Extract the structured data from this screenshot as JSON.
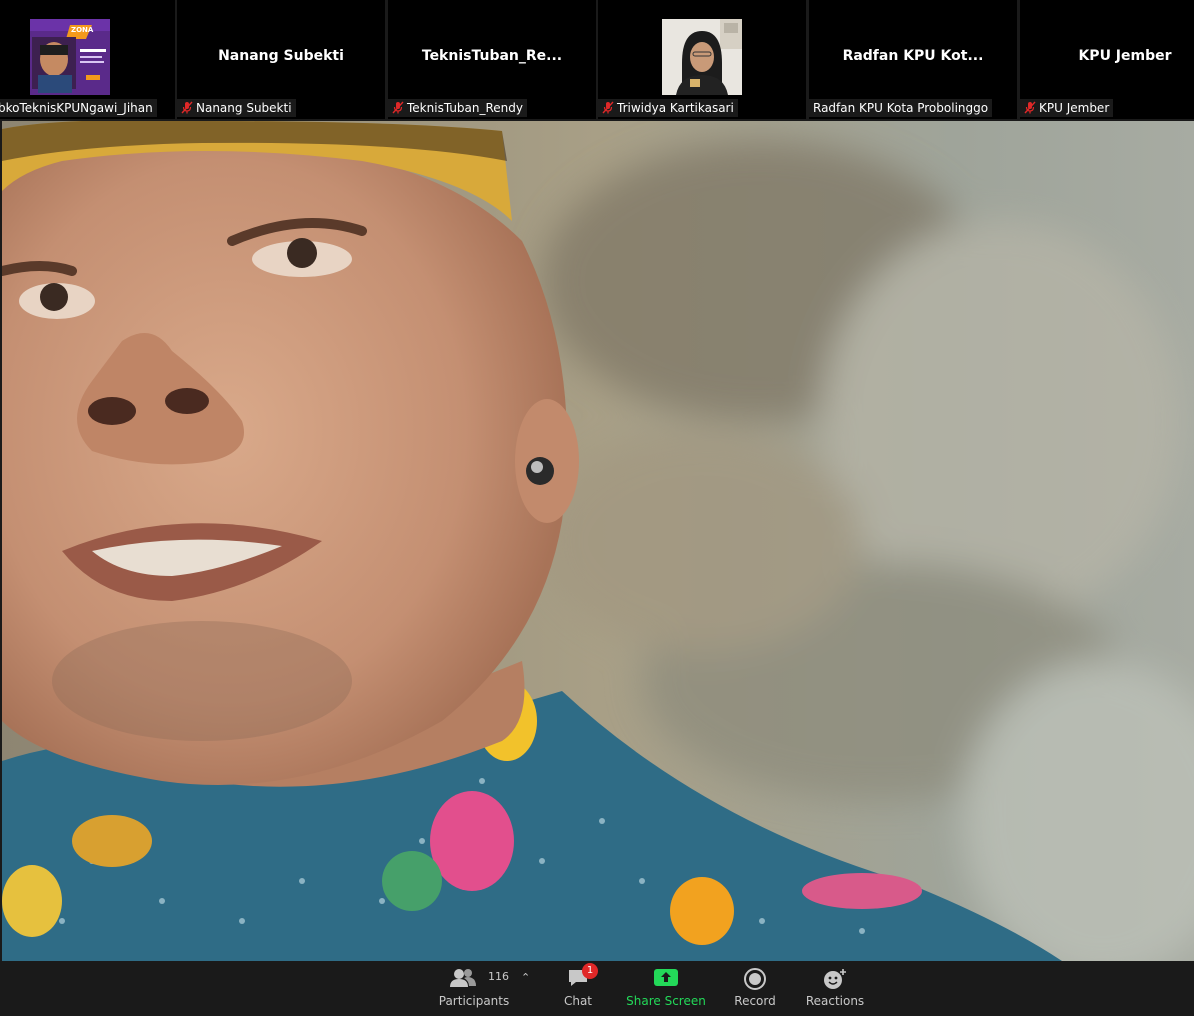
{
  "gallery": {
    "tiles": [
      {
        "label": "bkoTeknisKPUNgawi_Jihan",
        "muted": false
      },
      {
        "name": "Nanang Subekti",
        "label": "Nanang Subekti",
        "muted": true
      },
      {
        "name": "TeknisTuban_Re...",
        "label": "TeknisTuban_Rendy",
        "muted": true
      },
      {
        "label": "Triwidya Kartikasari",
        "muted": true
      },
      {
        "name": "Radfan KPU Kot...",
        "label": "Radfan KPU Kota Probolinggo",
        "muted": false
      },
      {
        "name": "KPU Jember",
        "label": "KPU Jember",
        "muted": true
      }
    ],
    "thumb_text": "ZONA"
  },
  "toolbar": {
    "participants": {
      "label": "Participants",
      "count": "116",
      "icon": "participants-icon"
    },
    "chat": {
      "label": "Chat",
      "badge": "1",
      "icon": "chat-icon"
    },
    "share": {
      "label": "Share Screen",
      "icon": "share-screen-icon"
    },
    "record": {
      "label": "Record",
      "icon": "record-icon"
    },
    "reactions": {
      "label": "Reactions",
      "icon": "reactions-icon"
    }
  },
  "colors": {
    "share_green": "#23d959",
    "mute_red": "#e02828",
    "toolbar_text": "#c8c8c8"
  }
}
